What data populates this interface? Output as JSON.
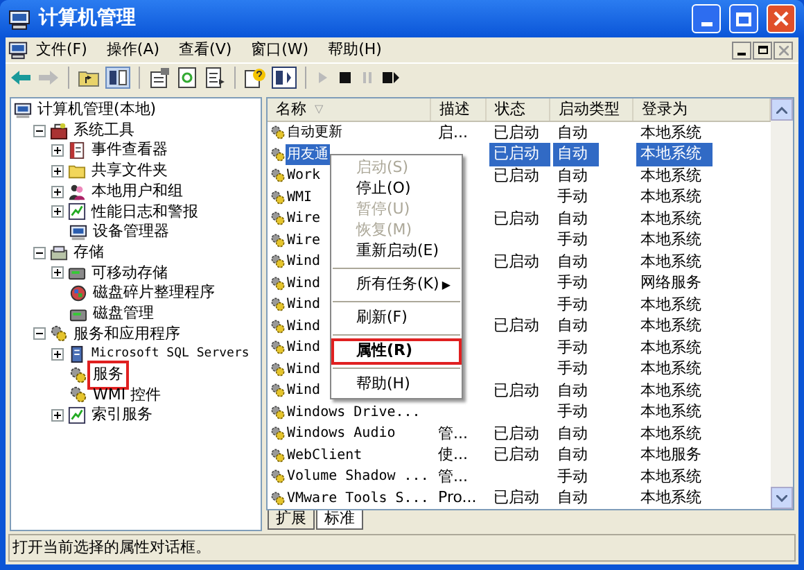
{
  "window": {
    "title": "计算机管理"
  },
  "menu": [
    "文件(F)",
    "操作(A)",
    "查看(V)",
    "窗口(W)",
    "帮助(H)"
  ],
  "tree": [
    {
      "label": "计算机管理(本地)",
      "kind": "computer",
      "children": [
        {
          "label": "系统工具",
          "kind": "tools",
          "expanded": true,
          "children": [
            {
              "label": "事件查看器",
              "kind": "log",
              "expanded": false
            },
            {
              "label": "共享文件夹",
              "kind": "folder",
              "expanded": false
            },
            {
              "label": "本地用户和组",
              "kind": "users",
              "expanded": false
            },
            {
              "label": "性能日志和警报",
              "kind": "chart",
              "expanded": false
            },
            {
              "label": "设备管理器",
              "kind": "computer"
            }
          ]
        },
        {
          "label": "存储",
          "kind": "storage",
          "expanded": true,
          "children": [
            {
              "label": "可移动存储",
              "kind": "disk",
              "expanded": false
            },
            {
              "label": "磁盘碎片整理程序",
              "kind": "defrag"
            },
            {
              "label": "磁盘管理",
              "kind": "disk"
            }
          ]
        },
        {
          "label": "服务和应用程序",
          "kind": "gear",
          "expanded": true,
          "children": [
            {
              "label": "Microsoft SQL Servers",
              "kind": "server",
              "expanded": false
            },
            {
              "label": "服务",
              "kind": "gear",
              "annotated": true
            },
            {
              "label": "WMI 控件",
              "kind": "gear"
            },
            {
              "label": "索引服务",
              "kind": "chart",
              "expanded": false
            }
          ]
        }
      ]
    }
  ],
  "table": {
    "columns": [
      "名称",
      "描述",
      "状态",
      "启动类型",
      "登录为"
    ],
    "sort_mark": "▽",
    "rows": [
      {
        "name": "自动更新",
        "description": "启...",
        "status": "已启动",
        "startup": "自动",
        "logon": "本地系统",
        "selected": false
      },
      {
        "name": "用友通",
        "status": "已启动",
        "startup": "自动",
        "logon": "本地系统",
        "selected": true
      },
      {
        "name": "Work",
        "status": "已启动",
        "startup": "自动",
        "logon": "本地系统",
        "selected": false
      },
      {
        "name": "WMI",
        "startup": "手动",
        "logon": "本地系统",
        "selected": false
      },
      {
        "name": "Wire",
        "status": "已启动",
        "startup": "自动",
        "logon": "本地系统",
        "selected": false
      },
      {
        "name": "Wire",
        "startup": "手动",
        "logon": "本地系统",
        "selected": false
      },
      {
        "name": "Wind",
        "status": "已启动",
        "startup": "自动",
        "logon": "本地系统",
        "selected": false
      },
      {
        "name": "Wind",
        "startup": "手动",
        "logon": "网络服务",
        "selected": false
      },
      {
        "name": "Wind",
        "startup": "手动",
        "logon": "本地系统",
        "selected": false
      },
      {
        "name": "Wind",
        "status": "已启动",
        "startup": "自动",
        "logon": "本地系统",
        "selected": false
      },
      {
        "name": "Wind",
        "startup": "手动",
        "logon": "本地系统",
        "selected": false
      },
      {
        "name": "Wind",
        "startup": "手动",
        "logon": "本地系统",
        "selected": false
      },
      {
        "name": "Wind",
        "status": "已启动",
        "startup": "自动",
        "logon": "本地系统",
        "selected": false
      },
      {
        "name": "Windows Drive...",
        "startup": "手动",
        "logon": "本地系统",
        "selected": false
      },
      {
        "name": "Windows Audio",
        "description": "管...",
        "status": "已启动",
        "startup": "自动",
        "logon": "本地系统",
        "selected": false
      },
      {
        "name": "WebClient",
        "description": "使...",
        "status": "已启动",
        "startup": "自动",
        "logon": "本地服务",
        "selected": false
      },
      {
        "name": "Volume Shadow ...",
        "description": "管...",
        "startup": "手动",
        "logon": "本地系统",
        "selected": false
      },
      {
        "name": "VMware Tools S...",
        "description": "Pro...",
        "status": "已启动",
        "startup": "自动",
        "logon": "本地系统",
        "selected": false
      }
    ]
  },
  "context_menu": [
    {
      "kind": "item",
      "label": "启动(S)",
      "disabled": true
    },
    {
      "kind": "item",
      "label": "停止(O)",
      "disabled": false
    },
    {
      "kind": "item",
      "label": "暂停(U)",
      "disabled": true
    },
    {
      "kind": "item",
      "label": "恢复(M)",
      "disabled": true
    },
    {
      "kind": "item",
      "label": "重新启动(E)",
      "disabled": false
    },
    {
      "kind": "separator"
    },
    {
      "kind": "submenu",
      "label": "所有任务(K)",
      "arrow": "▶",
      "disabled": false
    },
    {
      "kind": "separator"
    },
    {
      "kind": "item",
      "label": "刷新(F)",
      "disabled": false
    },
    {
      "kind": "separator"
    },
    {
      "kind": "item",
      "label": "属性(R)",
      "disabled": false,
      "default": true,
      "annotated": true
    },
    {
      "kind": "separator"
    },
    {
      "kind": "item",
      "label": "帮助(H)",
      "disabled": false
    }
  ],
  "tabs": [
    {
      "label": "扩展",
      "selected": false
    },
    {
      "label": "标准",
      "selected": true
    }
  ],
  "status_bar": "打开当前选择的属性对话框。"
}
